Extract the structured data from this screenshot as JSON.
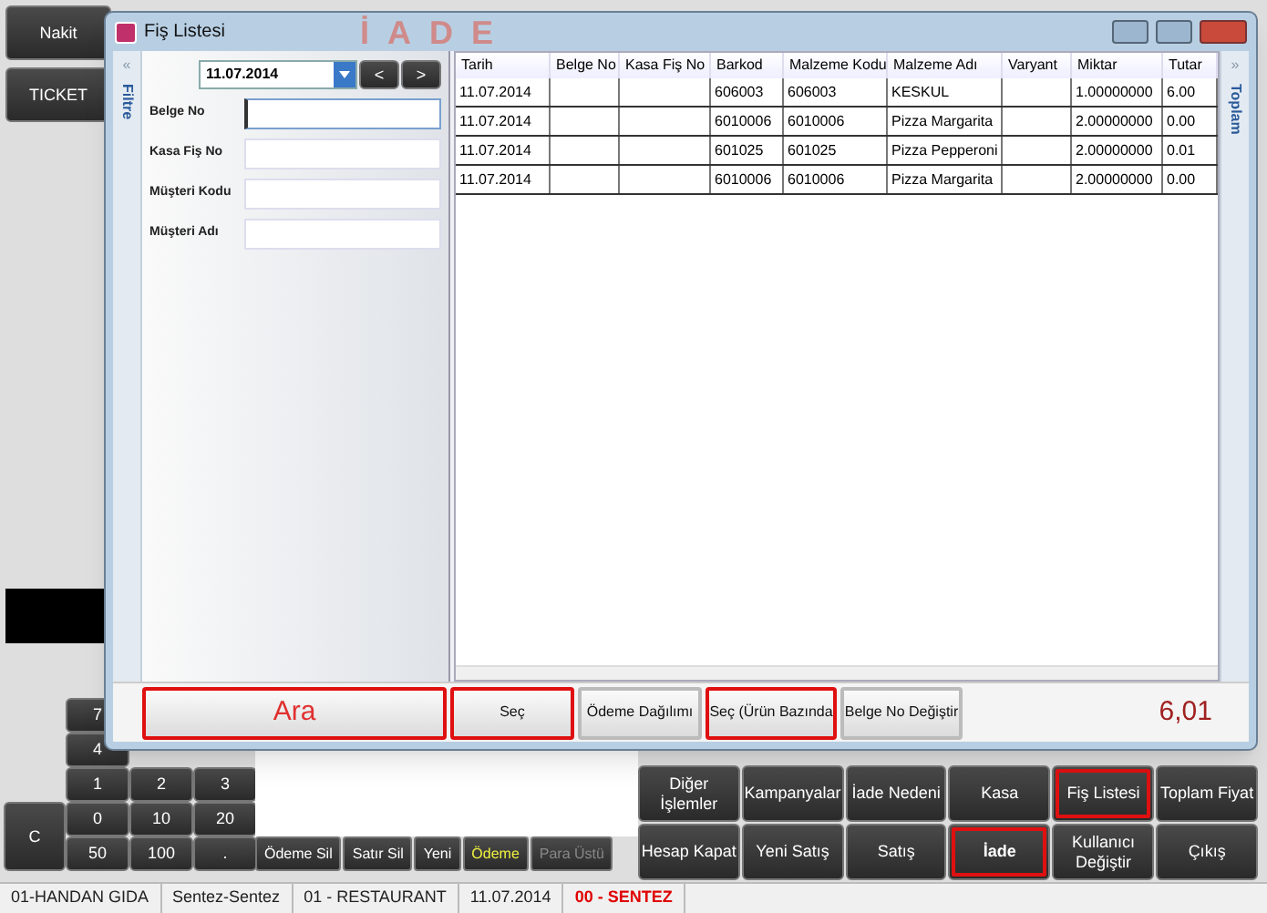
{
  "background": {
    "side_buttons": [
      "Nakit",
      "TICKET"
    ],
    "keypad": [
      {
        "label": "7"
      },
      {
        "label": "4"
      },
      {
        "label": "1"
      },
      {
        "label": "2"
      },
      {
        "label": "3"
      },
      {
        "label": "C"
      },
      {
        "label": "0"
      },
      {
        "label": "10"
      },
      {
        "label": "20"
      },
      {
        "label": "50"
      },
      {
        "label": "100"
      },
      {
        "label": "."
      }
    ],
    "small_buttons": [
      {
        "label": "Ödeme Sil",
        "kind": "normal"
      },
      {
        "label": "Satır Sil",
        "kind": "normal"
      },
      {
        "label": "Yeni",
        "kind": "normal"
      },
      {
        "label": "Ödeme",
        "kind": "accent"
      },
      {
        "label": "Para Üstü",
        "kind": "disabled"
      }
    ],
    "function_buttons": [
      {
        "label": "Diğer İşlemler",
        "highlighted": false,
        "alert": false
      },
      {
        "label": "Kampanyalar",
        "highlighted": false,
        "alert": false
      },
      {
        "label": "İade Nedeni",
        "highlighted": false,
        "alert": false
      },
      {
        "label": "Kasa",
        "highlighted": false,
        "alert": false
      },
      {
        "label": "Fiş Listesi",
        "highlighted": true,
        "alert": false
      },
      {
        "label": "Toplam Fiyat",
        "highlighted": false,
        "alert": false
      },
      {
        "label": "Hesap Kapat",
        "highlighted": false,
        "alert": false
      },
      {
        "label": "Yeni Satış",
        "highlighted": false,
        "alert": false
      },
      {
        "label": "Satış",
        "highlighted": false,
        "alert": false
      },
      {
        "label": "İade",
        "highlighted": true,
        "alert": true
      },
      {
        "label": "Kullanıcı Değiştir",
        "highlighted": false,
        "alert": false
      },
      {
        "label": "Çıkış",
        "highlighted": false,
        "alert": false
      }
    ],
    "banner": "İADE"
  },
  "window": {
    "title": "Fiş Listesi"
  },
  "filter": {
    "tab_label": "Filtre",
    "collapse_glyph": "«",
    "date": "11.07.2014",
    "prev": "<",
    "next": ">",
    "fields": [
      {
        "label": "Belge No",
        "focused": true
      },
      {
        "label": "Kasa Fiş No",
        "focused": false
      },
      {
        "label": "Müşteri Kodu",
        "focused": false
      },
      {
        "label": "Müşteri Adı",
        "focused": false
      }
    ]
  },
  "table": {
    "columns": [
      "Tarih",
      "Belge No",
      "Kasa Fiş No",
      "Barkod",
      "Malzeme Kodu",
      "Malzeme Adı",
      "Varyant",
      "Miktar",
      "Tutar"
    ],
    "rows": [
      [
        "11.07.2014",
        "",
        "",
        "606003",
        "606003",
        "KESKUL",
        "",
        "1.00000000",
        "6.00"
      ],
      [
        "11.07.2014",
        "",
        "",
        "6010006",
        "6010006",
        "Pizza Margarita",
        "",
        "2.00000000",
        "0.00"
      ],
      [
        "11.07.2014",
        "",
        "",
        "601025",
        "601025",
        "Pizza Pepperoni",
        "",
        "2.00000000",
        "0.01"
      ],
      [
        "11.07.2014",
        "",
        "",
        "6010006",
        "6010006",
        "Pizza Margarita",
        "",
        "2.00000000",
        "0.00"
      ]
    ]
  },
  "total_tab": {
    "label": "Toplam",
    "expand_glyph": "»"
  },
  "dialog_buttons": [
    {
      "label": "Ara",
      "highlighted": true,
      "alert": true
    },
    {
      "label": "Seç",
      "highlighted": true,
      "alert": false
    },
    {
      "label": "Ödeme Dağılımı",
      "highlighted": false,
      "alert": false
    },
    {
      "label": "Seç (Ürün Bazında",
      "highlighted": true,
      "alert": false
    },
    {
      "label": "Belge No Değiştir",
      "highlighted": false,
      "alert": false
    }
  ],
  "total": "6,01",
  "status_bar": [
    {
      "text": "01-HANDAN GIDA",
      "alert": false
    },
    {
      "text": "Sentez-Sentez",
      "alert": false
    },
    {
      "text": "01 - RESTAURANT",
      "alert": false
    },
    {
      "text": "11.07.2014",
      "alert": false
    },
    {
      "text": "00 - SENTEZ",
      "alert": true
    }
  ]
}
